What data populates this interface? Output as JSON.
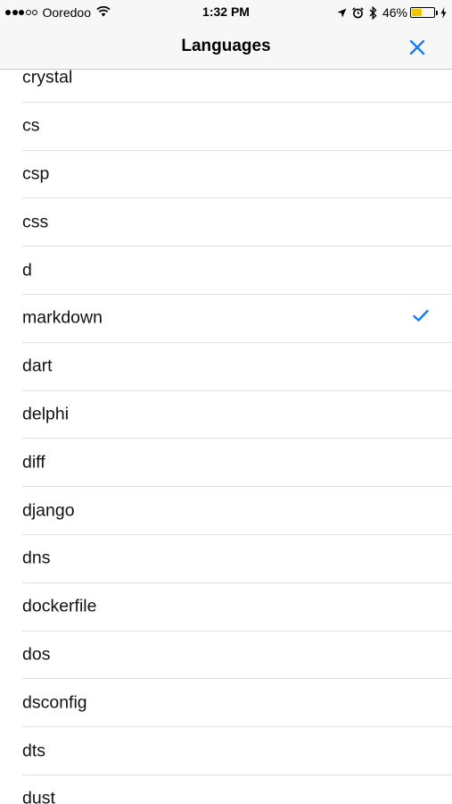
{
  "status_bar": {
    "carrier": "Ooredoo",
    "time": "1:32 PM",
    "battery_percent": "46%",
    "battery_level": 0.46,
    "signal_bars_filled": 3,
    "signal_bars_total": 5,
    "icons": [
      "wifi-icon",
      "location-arrow-icon",
      "alarm-clock-icon",
      "bluetooth-icon",
      "battery-icon",
      "charging-bolt-icon"
    ]
  },
  "nav": {
    "title": "Languages",
    "close_icon": "close-icon"
  },
  "colors": {
    "accent": "#1a7cf5",
    "battery": "#f5c400"
  },
  "languages": [
    {
      "label": "crystal",
      "selected": false
    },
    {
      "label": "cs",
      "selected": false
    },
    {
      "label": "csp",
      "selected": false
    },
    {
      "label": "css",
      "selected": false
    },
    {
      "label": "d",
      "selected": false
    },
    {
      "label": "markdown",
      "selected": true
    },
    {
      "label": "dart",
      "selected": false
    },
    {
      "label": "delphi",
      "selected": false
    },
    {
      "label": "diff",
      "selected": false
    },
    {
      "label": "django",
      "selected": false
    },
    {
      "label": "dns",
      "selected": false
    },
    {
      "label": "dockerfile",
      "selected": false
    },
    {
      "label": "dos",
      "selected": false
    },
    {
      "label": "dsconfig",
      "selected": false
    },
    {
      "label": "dts",
      "selected": false
    },
    {
      "label": "dust",
      "selected": false
    }
  ]
}
